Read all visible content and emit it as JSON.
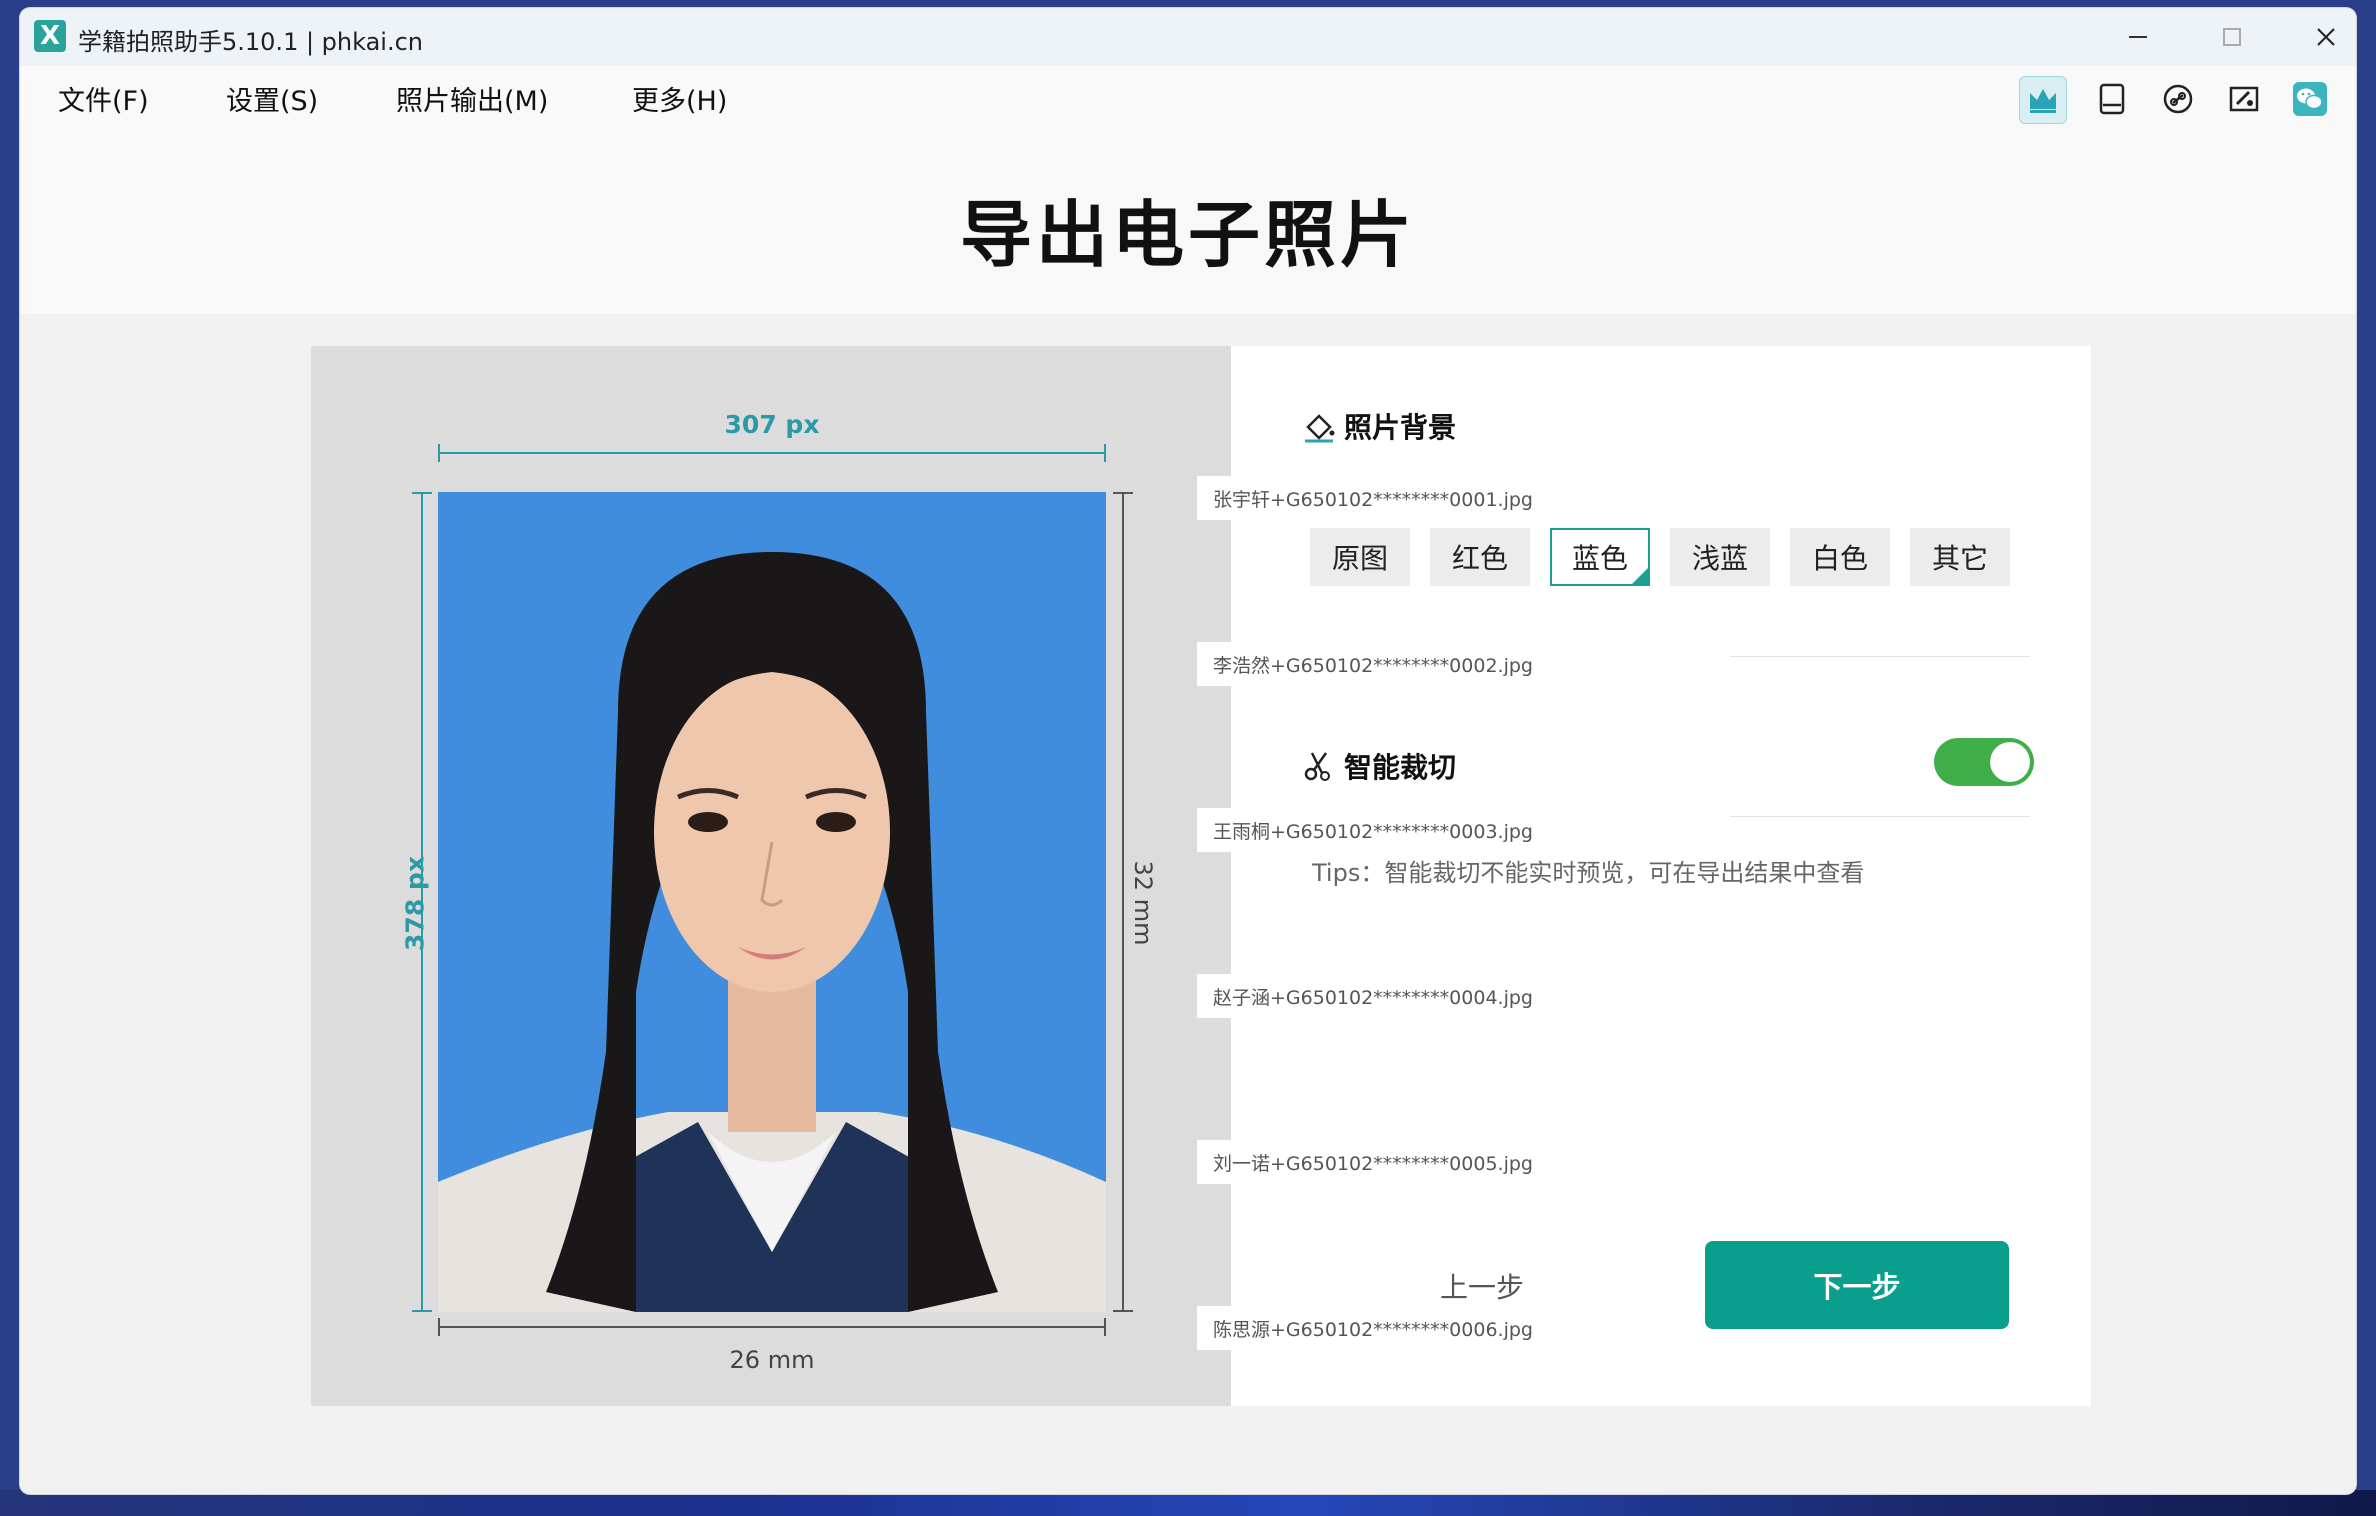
{
  "window": {
    "title": "学籍拍照助手5.10.1 | phkai.cn",
    "logo_letter": "X"
  },
  "menu": [
    {
      "label": "文件(F)"
    },
    {
      "label": "设置(S)"
    },
    {
      "label": "照片输出(M)"
    },
    {
      "label": "更多(H)"
    }
  ],
  "toolbar_icons": [
    "crown-icon",
    "tablet-icon",
    "link-icon",
    "edit-image-icon",
    "wechat-icon"
  ],
  "page_title": "导出电子照片",
  "photo": {
    "width_px_label": "307 px",
    "height_px_label": "378 px",
    "width_mm_label": "26 mm",
    "height_mm_label": "32 mm",
    "background_color": "#3f8ddc"
  },
  "background_section": {
    "title": "照片背景",
    "options": [
      "原图",
      "红色",
      "蓝色",
      "浅蓝",
      "白色",
      "其它"
    ],
    "selected": "蓝色"
  },
  "crop_section": {
    "title": "智能裁切",
    "enabled": true,
    "tips": "Tips：智能裁切不能实时预览，可在导出结果中查看"
  },
  "files": [
    "张宇轩+G650102********0001.jpg",
    "李浩然+G650102********0002.jpg",
    "王雨桐+G650102********0003.jpg",
    "赵子涵+G650102********0004.jpg",
    "刘一诺+G650102********0005.jpg",
    "陈思源+G650102********0006.jpg"
  ],
  "buttons": {
    "prev": "上一步",
    "next": "下一步"
  },
  "colors": {
    "accent": "#0a9e8c",
    "toggle_on": "#3fae49",
    "dimension": "#2a9aa6"
  }
}
